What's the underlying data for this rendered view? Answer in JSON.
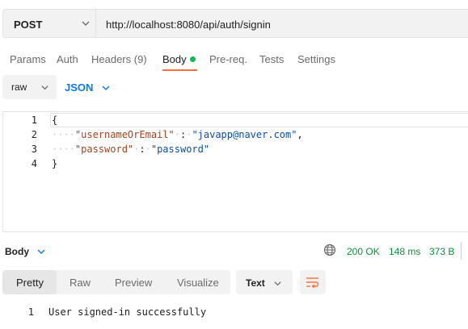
{
  "request": {
    "method": "POST",
    "url": "http://localhost:8080/api/auth/signin"
  },
  "tabs": [
    {
      "label": "Params"
    },
    {
      "label": "Auth"
    },
    {
      "label": "Headers (9)"
    },
    {
      "label": "Body"
    },
    {
      "label": "Pre-req."
    },
    {
      "label": "Tests"
    },
    {
      "label": "Settings"
    }
  ],
  "active_tab": "Body",
  "body_mode": {
    "type": "raw",
    "format": "JSON"
  },
  "editor": {
    "line_numbers": [
      "1",
      "2",
      "3",
      "4"
    ],
    "open_brace": "{",
    "close_brace": "}",
    "fields": [
      {
        "key": "\"usernameOrEmail\"",
        "value": "\"javapp@naver.com\"",
        "trailing": ","
      },
      {
        "key": "\"password\"",
        "value": "\"password\"",
        "trailing": ""
      }
    ],
    "colon": ":"
  },
  "response": {
    "section_label": "Body",
    "status": "200 OK",
    "time": "148 ms",
    "size": "373 B",
    "view_tabs": [
      {
        "label": "Pretty"
      },
      {
        "label": "Raw"
      },
      {
        "label": "Preview"
      },
      {
        "label": "Visualize"
      }
    ],
    "active_view": "Pretty",
    "format": "Text",
    "line_numbers": [
      "1"
    ],
    "lines": [
      "User signed-in successfully"
    ]
  },
  "colors": {
    "accent": "#ff6c37",
    "success": "#0a8f3f",
    "link": "#097bed",
    "body_dot": "#0cbb52"
  },
  "icons": {
    "method_dropdown": "chevron-down-icon",
    "globe": "globe-icon",
    "wrap": "wrap-lines-icon"
  }
}
